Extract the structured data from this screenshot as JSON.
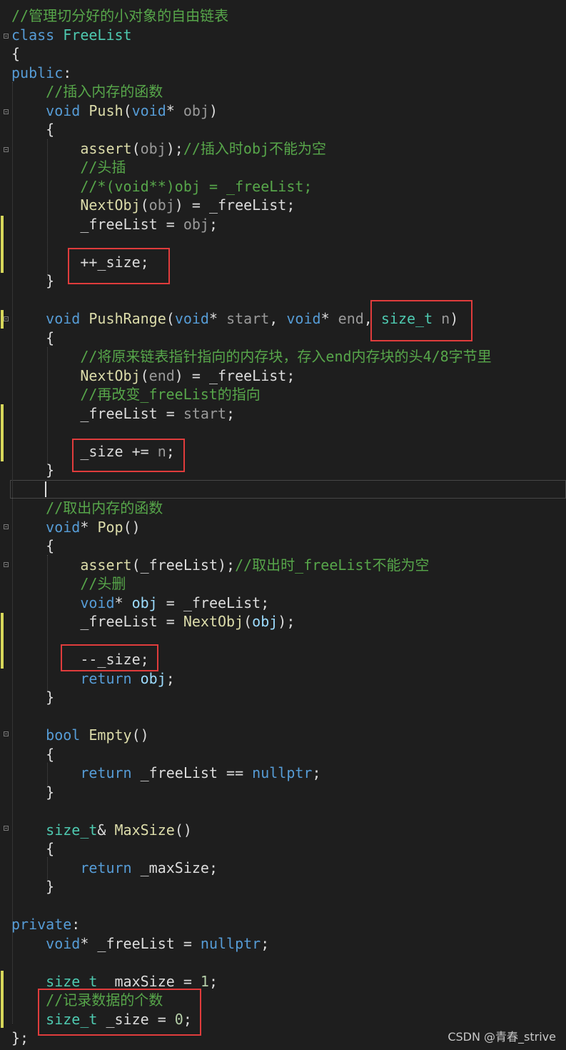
{
  "editor": {
    "lines": [
      [
        {
          "t": "//管理切分好的小对象的自由链表",
          "c": "comment"
        }
      ],
      [
        {
          "t": "class ",
          "c": "kw"
        },
        {
          "t": "FreeList",
          "c": "type"
        }
      ],
      [
        {
          "t": "{",
          "c": "plain"
        }
      ],
      [
        {
          "t": "public",
          "c": "kw"
        },
        {
          "t": ":",
          "c": "plain"
        }
      ],
      [
        {
          "t": "    ",
          "c": "plain"
        },
        {
          "t": "//插入内存的函数",
          "c": "comment"
        }
      ],
      [
        {
          "t": "    ",
          "c": "plain"
        },
        {
          "t": "void ",
          "c": "kw"
        },
        {
          "t": "Push",
          "c": "fn"
        },
        {
          "t": "(",
          "c": "plain"
        },
        {
          "t": "void",
          "c": "kw"
        },
        {
          "t": "* ",
          "c": "plain"
        },
        {
          "t": "obj",
          "c": "param"
        },
        {
          "t": ")",
          "c": "plain"
        }
      ],
      [
        {
          "t": "    {",
          "c": "plain"
        }
      ],
      [
        {
          "t": "        ",
          "c": "plain"
        },
        {
          "t": "assert",
          "c": "fn"
        },
        {
          "t": "(",
          "c": "plain"
        },
        {
          "t": "obj",
          "c": "param"
        },
        {
          "t": ");",
          "c": "plain"
        },
        {
          "t": "//插入时obj不能为空",
          "c": "comment"
        }
      ],
      [
        {
          "t": "        ",
          "c": "plain"
        },
        {
          "t": "//头插",
          "c": "comment"
        }
      ],
      [
        {
          "t": "        ",
          "c": "plain"
        },
        {
          "t": "//*(void**)obj = _freeList;",
          "c": "comment"
        }
      ],
      [
        {
          "t": "        ",
          "c": "plain"
        },
        {
          "t": "NextObj",
          "c": "fn"
        },
        {
          "t": "(",
          "c": "plain"
        },
        {
          "t": "obj",
          "c": "param"
        },
        {
          "t": ") = _freeList;",
          "c": "plain"
        }
      ],
      [
        {
          "t": "        _freeList = ",
          "c": "plain"
        },
        {
          "t": "obj",
          "c": "param"
        },
        {
          "t": ";",
          "c": "plain"
        }
      ],
      [],
      [
        {
          "t": "        ++_size;",
          "c": "plain"
        }
      ],
      [
        {
          "t": "    }",
          "c": "plain"
        }
      ],
      [],
      [
        {
          "t": "    ",
          "c": "plain"
        },
        {
          "t": "void ",
          "c": "kw"
        },
        {
          "t": "PushRange",
          "c": "fn"
        },
        {
          "t": "(",
          "c": "plain"
        },
        {
          "t": "void",
          "c": "kw"
        },
        {
          "t": "* ",
          "c": "plain"
        },
        {
          "t": "start",
          "c": "param"
        },
        {
          "t": ", ",
          "c": "plain"
        },
        {
          "t": "void",
          "c": "kw"
        },
        {
          "t": "* ",
          "c": "plain"
        },
        {
          "t": "end",
          "c": "param"
        },
        {
          "t": ", ",
          "c": "plain"
        },
        {
          "t": "size_t",
          "c": "type"
        },
        {
          "t": " ",
          "c": "plain"
        },
        {
          "t": "n",
          "c": "param"
        },
        {
          "t": ")",
          "c": "plain"
        }
      ],
      [
        {
          "t": "    {",
          "c": "plain"
        }
      ],
      [
        {
          "t": "        ",
          "c": "plain"
        },
        {
          "t": "//将原来链表指针指向的内存块，存入end内存块的头4/8字节里",
          "c": "comment"
        }
      ],
      [
        {
          "t": "        ",
          "c": "plain"
        },
        {
          "t": "NextObj",
          "c": "fn"
        },
        {
          "t": "(",
          "c": "plain"
        },
        {
          "t": "end",
          "c": "param"
        },
        {
          "t": ") = _freeList;",
          "c": "plain"
        }
      ],
      [
        {
          "t": "        ",
          "c": "plain"
        },
        {
          "t": "//再改变_freeList的指向",
          "c": "comment"
        }
      ],
      [
        {
          "t": "        _freeList = ",
          "c": "plain"
        },
        {
          "t": "start",
          "c": "param"
        },
        {
          "t": ";",
          "c": "plain"
        }
      ],
      [],
      [
        {
          "t": "        _size += ",
          "c": "plain"
        },
        {
          "t": "n",
          "c": "param"
        },
        {
          "t": ";",
          "c": "plain"
        }
      ],
      [
        {
          "t": "    }",
          "c": "plain"
        }
      ],
      [],
      [
        {
          "t": "    ",
          "c": "plain"
        },
        {
          "t": "//取出内存的函数",
          "c": "comment"
        }
      ],
      [
        {
          "t": "    ",
          "c": "plain"
        },
        {
          "t": "void",
          "c": "kw"
        },
        {
          "t": "* ",
          "c": "plain"
        },
        {
          "t": "Pop",
          "c": "fn"
        },
        {
          "t": "()",
          "c": "plain"
        }
      ],
      [
        {
          "t": "    {",
          "c": "plain"
        }
      ],
      [
        {
          "t": "        ",
          "c": "plain"
        },
        {
          "t": "assert",
          "c": "fn"
        },
        {
          "t": "(_freeList);",
          "c": "plain"
        },
        {
          "t": "//取出时_freeList不能为空",
          "c": "comment"
        }
      ],
      [
        {
          "t": "        ",
          "c": "plain"
        },
        {
          "t": "//头删",
          "c": "comment"
        }
      ],
      [
        {
          "t": "        ",
          "c": "plain"
        },
        {
          "t": "void",
          "c": "kw"
        },
        {
          "t": "* ",
          "c": "plain"
        },
        {
          "t": "obj",
          "c": "var"
        },
        {
          "t": " = _freeList;",
          "c": "plain"
        }
      ],
      [
        {
          "t": "        _freeList = ",
          "c": "plain"
        },
        {
          "t": "NextObj",
          "c": "fn"
        },
        {
          "t": "(",
          "c": "plain"
        },
        {
          "t": "obj",
          "c": "var"
        },
        {
          "t": ");",
          "c": "plain"
        }
      ],
      [],
      [
        {
          "t": "        --_size;",
          "c": "plain"
        }
      ],
      [
        {
          "t": "        ",
          "c": "plain"
        },
        {
          "t": "return ",
          "c": "kw"
        },
        {
          "t": "obj",
          "c": "var"
        },
        {
          "t": ";",
          "c": "plain"
        }
      ],
      [
        {
          "t": "    }",
          "c": "plain"
        }
      ],
      [],
      [
        {
          "t": "    ",
          "c": "plain"
        },
        {
          "t": "bool ",
          "c": "kw"
        },
        {
          "t": "Empty",
          "c": "fn"
        },
        {
          "t": "()",
          "c": "plain"
        }
      ],
      [
        {
          "t": "    {",
          "c": "plain"
        }
      ],
      [
        {
          "t": "        ",
          "c": "plain"
        },
        {
          "t": "return ",
          "c": "kw"
        },
        {
          "t": "_freeList == ",
          "c": "plain"
        },
        {
          "t": "nullptr",
          "c": "kw"
        },
        {
          "t": ";",
          "c": "plain"
        }
      ],
      [
        {
          "t": "    }",
          "c": "plain"
        }
      ],
      [],
      [
        {
          "t": "    ",
          "c": "plain"
        },
        {
          "t": "size_t",
          "c": "type"
        },
        {
          "t": "& ",
          "c": "plain"
        },
        {
          "t": "MaxSize",
          "c": "fn"
        },
        {
          "t": "()",
          "c": "plain"
        }
      ],
      [
        {
          "t": "    {",
          "c": "plain"
        }
      ],
      [
        {
          "t": "        ",
          "c": "plain"
        },
        {
          "t": "return ",
          "c": "kw"
        },
        {
          "t": "_maxSize;",
          "c": "plain"
        }
      ],
      [
        {
          "t": "    }",
          "c": "plain"
        }
      ],
      [],
      [
        {
          "t": "private",
          "c": "kw"
        },
        {
          "t": ":",
          "c": "plain"
        }
      ],
      [
        {
          "t": "    ",
          "c": "plain"
        },
        {
          "t": "void",
          "c": "kw"
        },
        {
          "t": "* _freeList = ",
          "c": "plain"
        },
        {
          "t": "nullptr",
          "c": "kw"
        },
        {
          "t": ";",
          "c": "plain"
        }
      ],
      [],
      [
        {
          "t": "    ",
          "c": "plain"
        },
        {
          "t": "size_t",
          "c": "type"
        },
        {
          "t": " _maxSize = ",
          "c": "plain"
        },
        {
          "t": "1",
          "c": "num"
        },
        {
          "t": ";",
          "c": "plain"
        }
      ],
      [
        {
          "t": "    ",
          "c": "plain"
        },
        {
          "t": "//记录数据的个数",
          "c": "comment"
        }
      ],
      [
        {
          "t": "    ",
          "c": "plain"
        },
        {
          "t": "size_t",
          "c": "type"
        },
        {
          "t": " _size = ",
          "c": "plain"
        },
        {
          "t": "0",
          "c": "num"
        },
        {
          "t": ";",
          "c": "plain"
        }
      ],
      [
        {
          "t": "};",
          "c": "plain"
        }
      ]
    ]
  },
  "watermark": "CSDN @青春_strive",
  "colors": {
    "background": "#1e1e1e",
    "highlight_box": "#e03c3c",
    "change_bar": "#d7d75a",
    "comment": "#57a64a",
    "keyword": "#569cd6",
    "function": "#dcdcaa",
    "type": "#4ec9b0"
  }
}
